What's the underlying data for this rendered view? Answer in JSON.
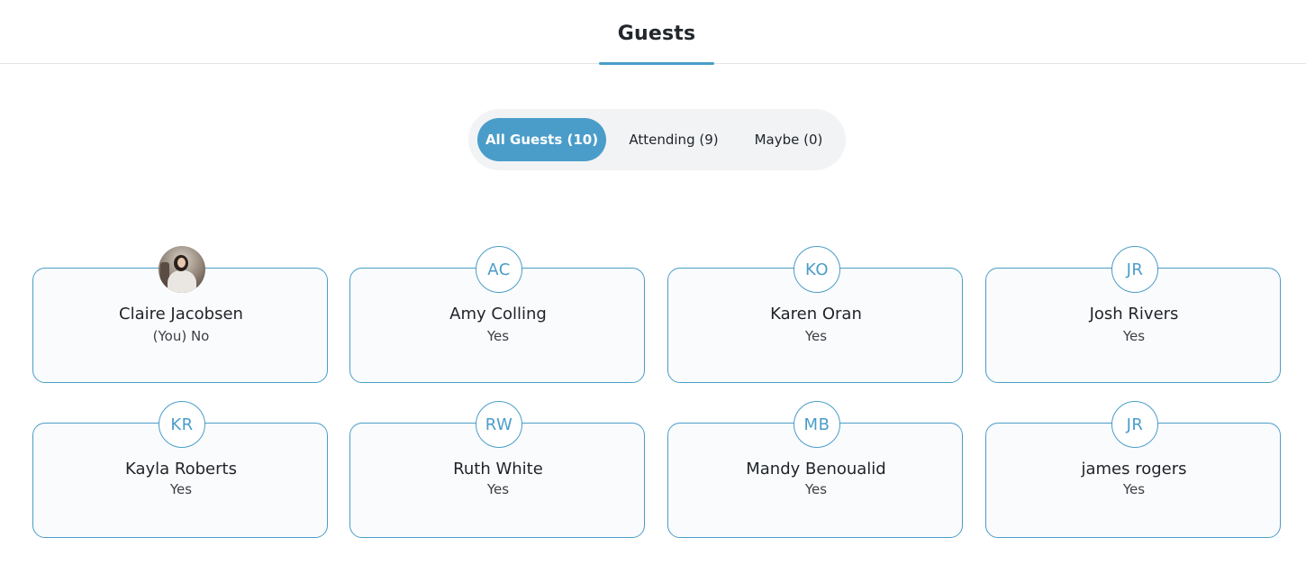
{
  "header": {
    "title": "Guests"
  },
  "filters": [
    {
      "label": "All Guests (10)",
      "active": true
    },
    {
      "label": "Attending (9)",
      "active": false
    },
    {
      "label": "Maybe (0)",
      "active": false
    }
  ],
  "guests": [
    {
      "name": "Claire Jacobsen",
      "status": "(You) No",
      "initials": "",
      "avatar": "photo"
    },
    {
      "name": "Amy Colling",
      "status": "Yes",
      "initials": "AC",
      "avatar": "initials"
    },
    {
      "name": "Karen Oran",
      "status": "Yes",
      "initials": "KO",
      "avatar": "initials"
    },
    {
      "name": "Josh Rivers",
      "status": "Yes",
      "initials": "JR",
      "avatar": "initials"
    },
    {
      "name": "Kayla Roberts",
      "status": "Yes",
      "initials": "KR",
      "avatar": "initials"
    },
    {
      "name": "Ruth White",
      "status": "Yes",
      "initials": "RW",
      "avatar": "initials"
    },
    {
      "name": "Mandy Benoualid",
      "status": "Yes",
      "initials": "MB",
      "avatar": "initials"
    },
    {
      "name": "james rogers",
      "status": "Yes",
      "initials": "JR",
      "avatar": "initials"
    }
  ],
  "colors": {
    "accent": "#4a9dc9",
    "filter_bg": "#f2f3f5",
    "card_bg": "#fafbfc"
  }
}
